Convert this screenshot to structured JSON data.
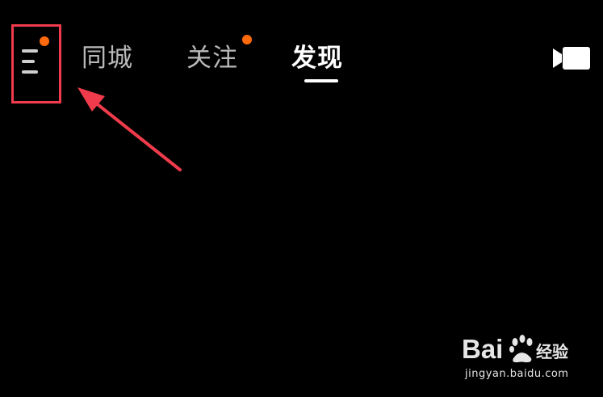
{
  "top_nav": {
    "menu": {
      "icon": "hamburger-menu-icon",
      "has_notification_dot": true,
      "highlight_color": "#ef3b4b"
    },
    "tabs": [
      {
        "label": "同城",
        "active": false,
        "has_dot": false
      },
      {
        "label": "关注",
        "active": false,
        "has_dot": true
      },
      {
        "label": "发现",
        "active": true,
        "has_dot": false
      }
    ],
    "camera": {
      "icon": "video-camera-icon"
    }
  },
  "colors": {
    "background": "#000000",
    "notification_dot": "#fe6a0c",
    "annotation": "#ef3b4b",
    "active_tab": "#ffffff",
    "inactive_tab": "#b9b9b9"
  },
  "watermark": {
    "logo_text": "Bai 经验",
    "url": "jingyan.baidu.com"
  }
}
